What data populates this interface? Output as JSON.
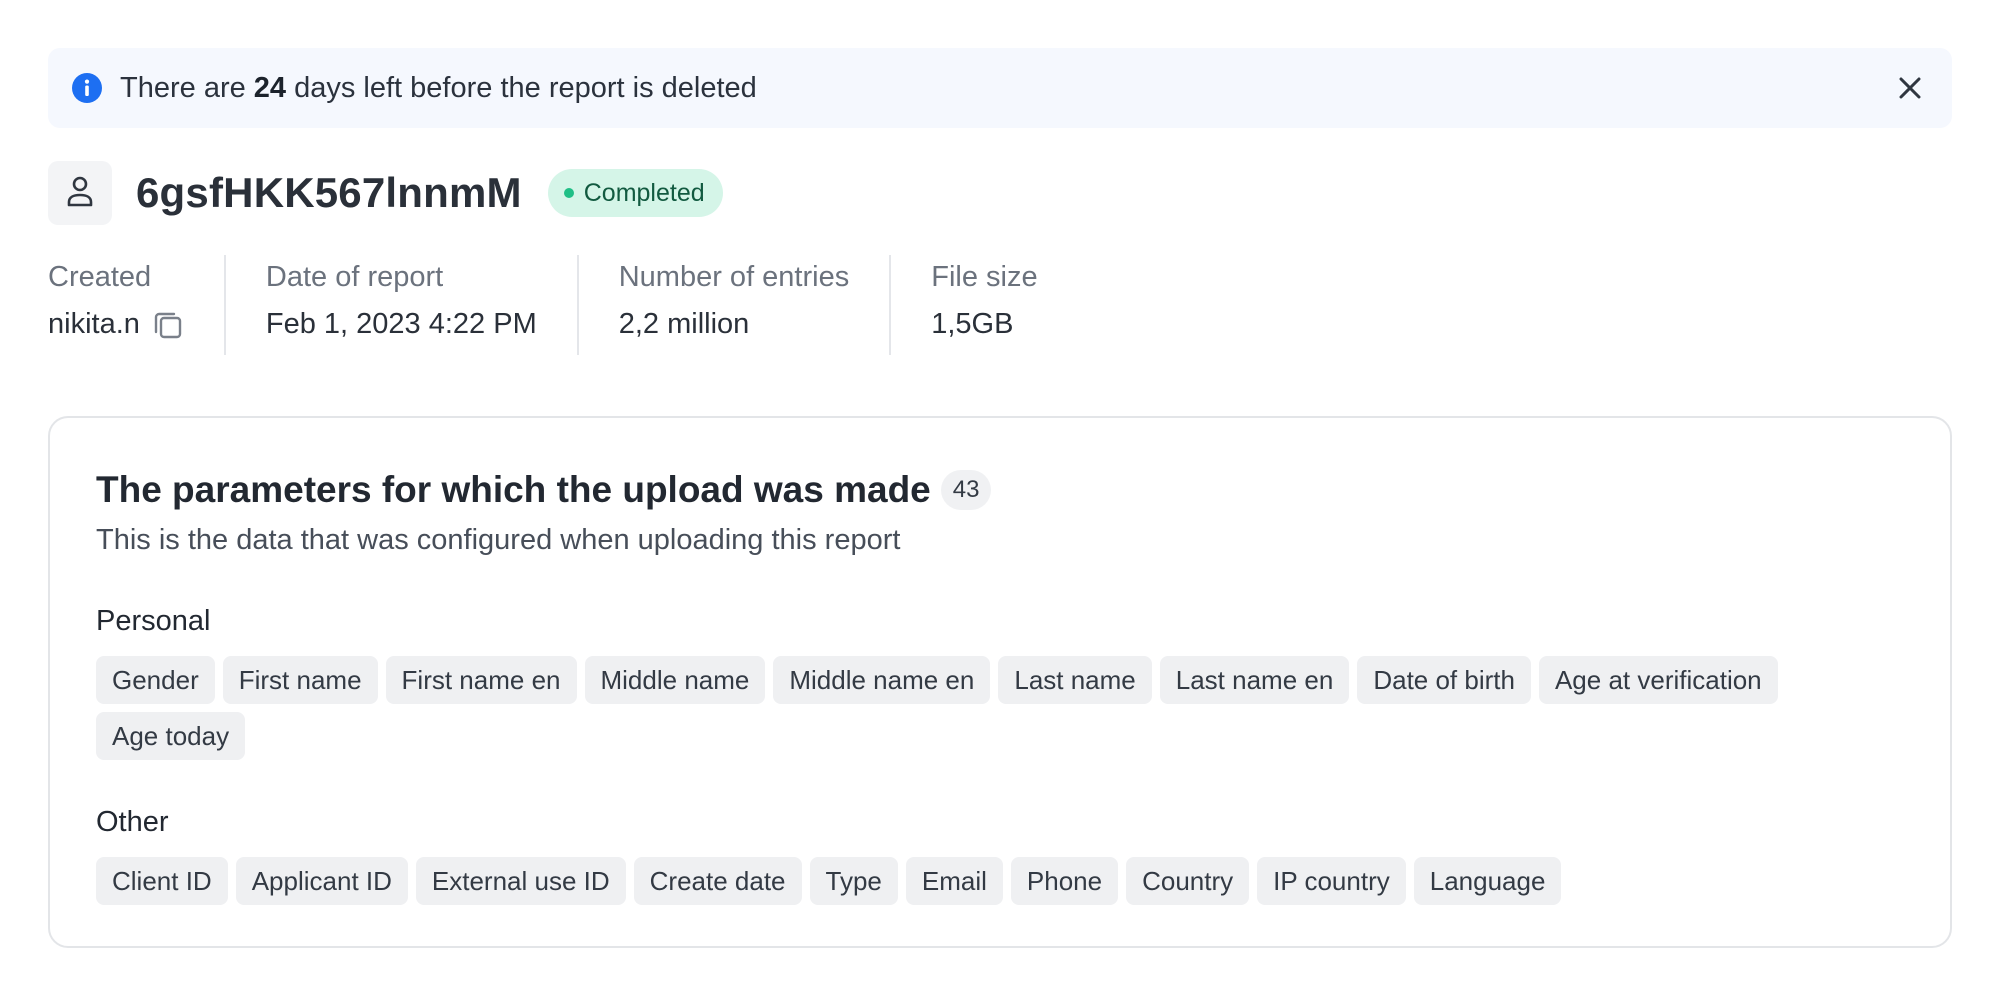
{
  "notice": {
    "prefix": "There are ",
    "days": "24",
    "suffix": " days left before the report is deleted",
    "icon": "info-icon",
    "close_icon": "close-icon"
  },
  "header": {
    "avatar_icon": "user-icon",
    "report_id": "6gsfHKK567lnnmM",
    "status": "Completed",
    "status_color": "#1fbf86"
  },
  "meta": {
    "created_label": "Created",
    "created_value": "nikita.n",
    "copy_icon": "copy-icon",
    "date_label": "Date of report",
    "date_value": "Feb 1, 2023 4:22 PM",
    "entries_label": "Number of entries",
    "entries_value": "2,2 million",
    "size_label": "File size",
    "size_value": "1,5GB"
  },
  "params": {
    "title": "The parameters for which the upload was made",
    "count": "43",
    "subtitle": "This is the data that was configured when uploading this report",
    "groups": [
      {
        "title": "Personal",
        "tags": [
          "Gender",
          "First name",
          "First name en",
          "Middle name",
          "Middle name en",
          "Last name",
          "Last name en",
          "Date of birth",
          "Age at verification",
          "Age today"
        ]
      },
      {
        "title": "Other",
        "tags": [
          "Client ID",
          "Applicant ID",
          "External use ID",
          "Create date",
          "Type",
          "Email",
          "Phone",
          "Country",
          "IP country",
          "Language"
        ]
      }
    ]
  },
  "colors": {
    "accent": "#1d6ff2",
    "banner_bg": "#f5f8fe",
    "badge_bg": "#d5f5e8",
    "tag_bg": "#eff0f2"
  }
}
